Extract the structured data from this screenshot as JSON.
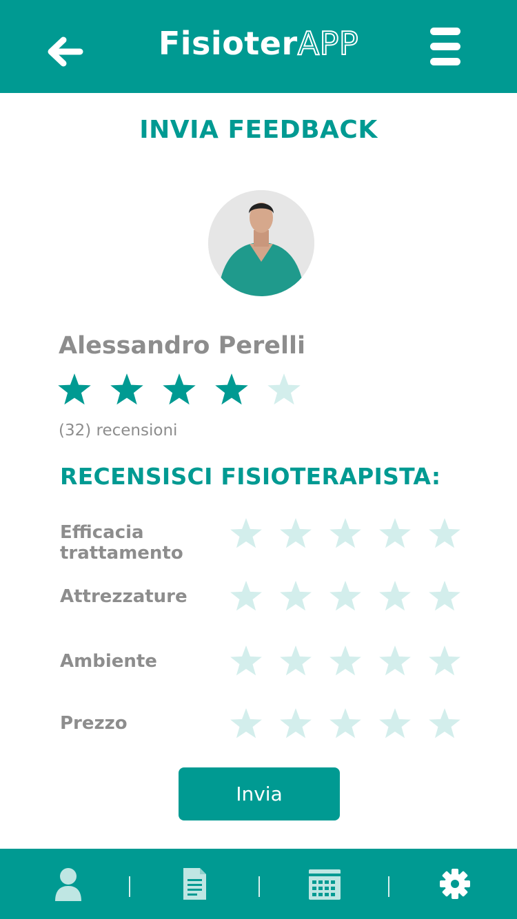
{
  "header": {
    "logo_part1": "Fisioter",
    "logo_part2": "APP",
    "back_icon": "arrow-left-icon",
    "menu_icon": "hamburger-menu-icon"
  },
  "page_title": "INVIA FEEDBACK",
  "doctor": {
    "name": "Alessandro Perelli",
    "rating": 4,
    "max_rating": 5,
    "reviews_text": "(32) recensioni"
  },
  "review_section": {
    "title": "RECENSISCI FISIOTERAPISTA:",
    "criteria": [
      {
        "label": "Efficacia trattamento",
        "rating": 0
      },
      {
        "label": "Attrezzature",
        "rating": 0
      },
      {
        "label": "Ambiente",
        "rating": 0
      },
      {
        "label": "Prezzo",
        "rating": 0
      }
    ]
  },
  "submit_label": "Invia",
  "bottom_nav": [
    {
      "icon": "user-icon"
    },
    {
      "icon": "document-icon"
    },
    {
      "icon": "calendar-icon"
    },
    {
      "icon": "settings-gear-icon"
    }
  ],
  "colors": {
    "primary": "#009a92",
    "star_filled": "#009a92",
    "star_empty": "#d3eeec",
    "text_gray": "#8d8d8d",
    "nav_icon": "#bfe6e3"
  }
}
